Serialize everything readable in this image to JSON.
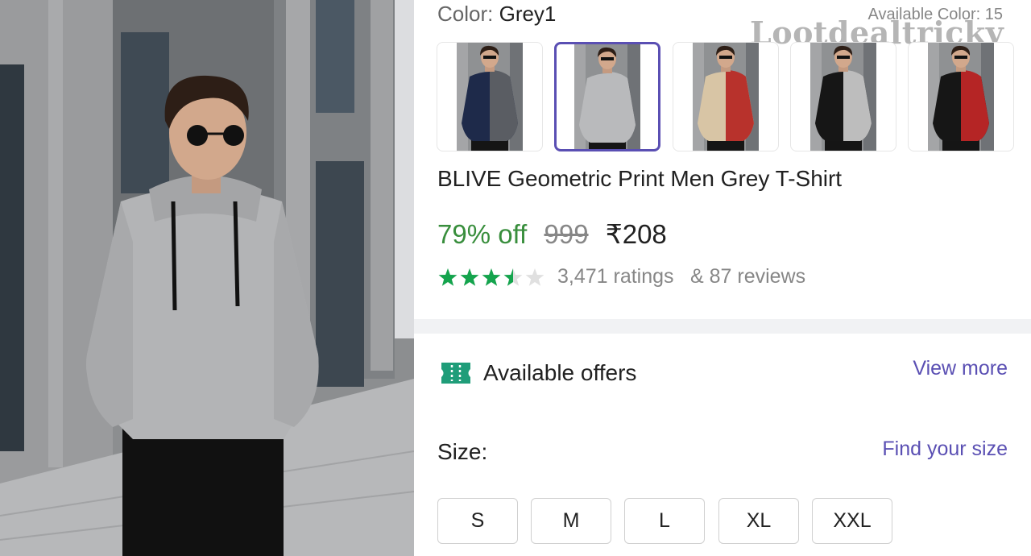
{
  "product": {
    "color_label": "Color:",
    "color_value": "Grey1",
    "available_colors": "Available Color: 15",
    "watermark": "Lootdealtricky",
    "title": "BLIVE Geometric Print Men Grey T-Shirt",
    "discount": "79% off",
    "mrp": "999",
    "price": "₹208",
    "rating_stars": 3.5,
    "ratings_count": "3,471 ratings",
    "reviews_count": "& 87 reviews"
  },
  "thumbnails": [
    {
      "name": "navy-grey",
      "left": "#1e2a4a",
      "right": "#5a5d63",
      "selected": false
    },
    {
      "name": "grey",
      "left": "#b9babc",
      "right": "#b9babc",
      "selected": true
    },
    {
      "name": "beige-red",
      "left": "#d8c5a5",
      "right": "#b8322c",
      "selected": false
    },
    {
      "name": "black-grey",
      "left": "#161616",
      "right": "#bdbdbd",
      "selected": false
    },
    {
      "name": "black-red",
      "left": "#161616",
      "right": "#b52525",
      "selected": false
    }
  ],
  "offers": {
    "title": "Available offers",
    "view_more": "View more"
  },
  "size": {
    "label": "Size:",
    "find_size": "Find your size",
    "options": [
      "S",
      "M",
      "L",
      "XL",
      "XXL"
    ]
  },
  "colors": {
    "accent": "#5a4fb3",
    "discount_green": "#388e3c",
    "star_green": "#14a44d"
  }
}
